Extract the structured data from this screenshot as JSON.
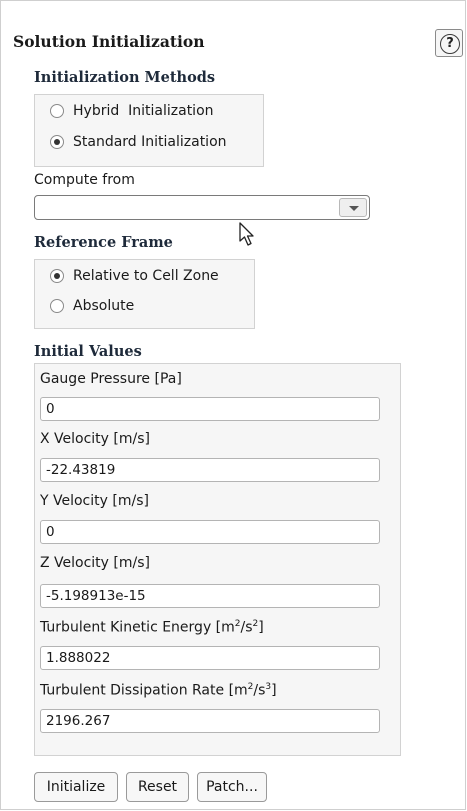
{
  "panel": {
    "title": "Solution Initialization",
    "help_glyph": "?"
  },
  "init_methods": {
    "title": "Initialization Methods",
    "options": [
      {
        "label": "Hybrid  Initialization",
        "selected": false
      },
      {
        "label": "Standard Initialization",
        "selected": true
      }
    ]
  },
  "compute_from": {
    "label": "Compute from",
    "value": ""
  },
  "reference_frame": {
    "title": "Reference Frame",
    "options": [
      {
        "label": "Relative to Cell Zone",
        "selected": true
      },
      {
        "label": "Absolute",
        "selected": false
      }
    ]
  },
  "initial_values": {
    "title": "Initial Values",
    "fields": [
      {
        "label": "Gauge Pressure [Pa]",
        "value": "0"
      },
      {
        "label": "X Velocity [m/s]",
        "value": "-22.43819"
      },
      {
        "label": "Y Velocity [m/s]",
        "value": "0"
      },
      {
        "label": "Z Velocity [m/s]",
        "value": "-5.198913e-15"
      },
      {
        "label_main": "Turbulent Kinetic Energy [m",
        "label_sup1": "2",
        "label_mid": "/s",
        "label_sup2": "2",
        "label_end": "]",
        "value": "1.888022"
      },
      {
        "label_main": "Turbulent Dissipation Rate [m",
        "label_sup1": "2",
        "label_mid": "/s",
        "label_sup2": "3",
        "label_end": "]",
        "value": "2196.267"
      }
    ]
  },
  "buttons": {
    "initialize": "Initialize",
    "reset": "Reset",
    "patch": "Patch..."
  },
  "icons": {
    "help": "help-icon",
    "dropdown": "chevron-down-icon",
    "cursor": "mouse-pointer-icon"
  }
}
